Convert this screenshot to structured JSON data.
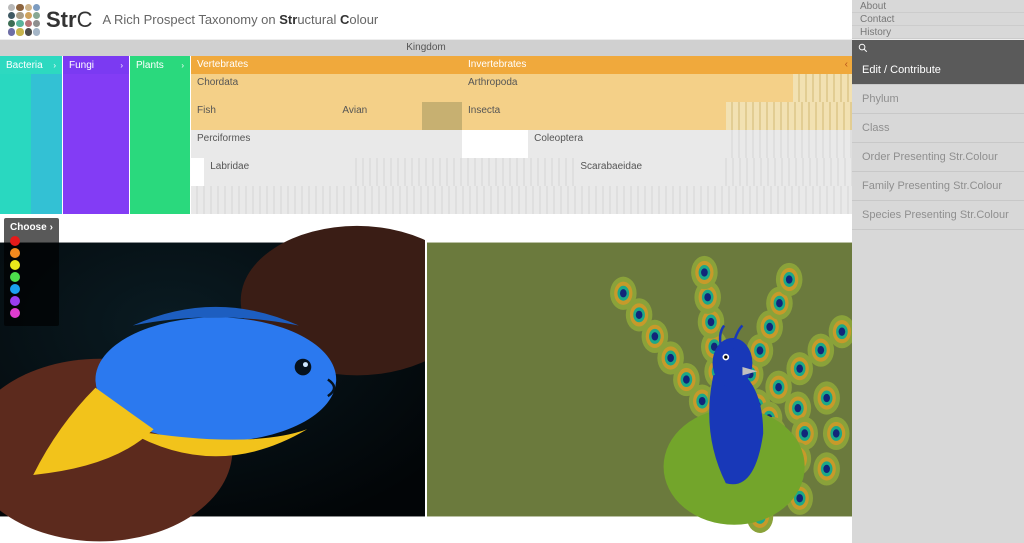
{
  "header": {
    "brand": "StrC",
    "subtitle_prefix": "A Rich Prospect Taxonomy on ",
    "subtitle_bold1": "Str",
    "subtitle_mid": "uctural ",
    "subtitle_bold2": "C",
    "subtitle_suffix": "olour",
    "nav": {
      "about": "About",
      "contact": "Contact",
      "history": "History"
    }
  },
  "kingdom_label": "Kingdom",
  "kingdoms": {
    "bacteria": "Bacteria",
    "fungi": "Fungi",
    "plants": "Plants",
    "animals_vert": "Vertebrates",
    "animals_invert": "Invertebrates"
  },
  "taxa": {
    "chordata": "Chordata",
    "arthropoda": "Arthropoda",
    "fish": "Fish",
    "avian": "Avian",
    "insecta": "Insecta",
    "perciformes": "Perciformes",
    "coleoptera": "Coleoptera",
    "labridae": "Labridae",
    "scarabaeidae": "Scarabaeidae"
  },
  "chooser": {
    "label": "Choose",
    "colors": [
      "#e51a1a",
      "#f28a1e",
      "#e8e81b",
      "#4de04d",
      "#1aa0f0",
      "#9a3cf0",
      "#e03ccf"
    ]
  },
  "side": {
    "edit": "Edit / Contribute",
    "phylum": "Phylum",
    "class": "Class",
    "order": "Order Presenting Str.Colour",
    "family": "Family Presenting Str.Colour",
    "species": "Species Presenting Str.Colour"
  },
  "logo_palette": [
    "#b9b9b9",
    "#8c643f",
    "#cdb38a",
    "#7d9cc0",
    "#3f5963",
    "#a79c87",
    "#cfa25b",
    "#87a893",
    "#3e6e55",
    "#5ab39c",
    "#b67676",
    "#8f8f8f",
    "#6e6ea6",
    "#c7b44b",
    "#4d4d4d",
    "#a5b6c7"
  ]
}
